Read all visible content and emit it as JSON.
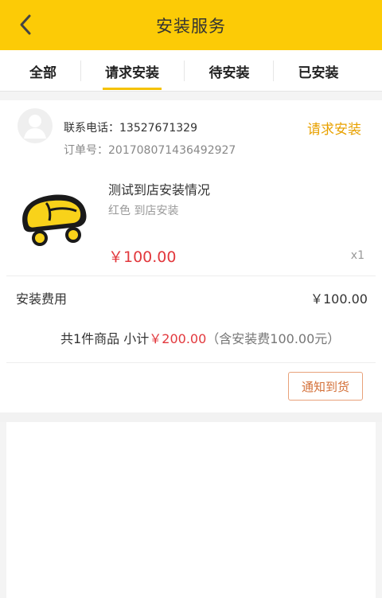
{
  "header": {
    "title": "安装服务"
  },
  "tabs": [
    {
      "label": "全部"
    },
    {
      "label": "请求安装"
    },
    {
      "label": "待安装"
    },
    {
      "label": "已安装"
    }
  ],
  "order": {
    "phone_label": "联系电话：13527671329",
    "order_no_label": "订单号：201708071436492927",
    "status": "请求安装"
  },
  "product": {
    "title": "测试到店安装情况",
    "spec": "红色 到店安装",
    "price": "￥100.00",
    "qty": "x1"
  },
  "fee": {
    "label": "安装费用",
    "value": "￥100.00"
  },
  "summary": {
    "prefix": "共1件商品 小计",
    "amount": "￥200.00",
    "note": "（含安装费100.00元）"
  },
  "actions": {
    "notify": "通知到货"
  },
  "colors": {
    "header_bg": "#fccb06",
    "status": "#e8a100",
    "price": "#e2383d"
  }
}
